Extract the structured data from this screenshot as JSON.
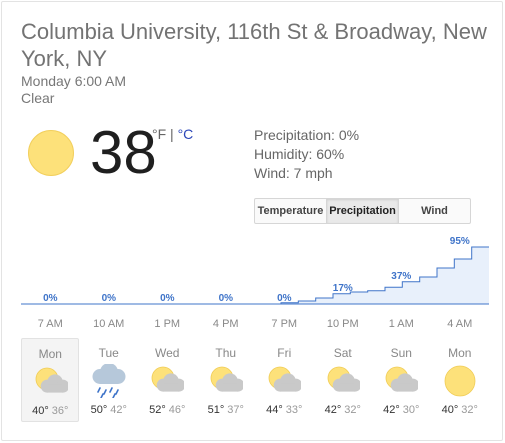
{
  "location": "Columbia University, 116th St & Broadway, New York, NY",
  "time": "Monday 6:00 AM",
  "condition": "Clear",
  "current": {
    "temperature": "38",
    "unit_f": "°F",
    "separator": " | ",
    "unit_c": "°C",
    "icon": "sun-icon"
  },
  "details": {
    "precipitation": "Precipitation: 0%",
    "humidity": "Humidity: 60%",
    "wind": "Wind: 7 mph"
  },
  "tabs": [
    {
      "label": "Temperature",
      "active": false
    },
    {
      "label": "Precipitation",
      "active": true
    },
    {
      "label": "Wind",
      "active": false
    }
  ],
  "chart_data": {
    "type": "area",
    "series": [
      {
        "values": [
          0,
          0,
          0,
          0,
          0,
          17,
          37,
          95
        ]
      }
    ],
    "categories": [
      "7 AM",
      "10 AM",
      "1 PM",
      "4 PM",
      "7 PM",
      "10 PM",
      "1 AM",
      "4 AM"
    ],
    "value_labels": [
      "0%",
      "0%",
      "0%",
      "0%",
      "0%",
      "17%",
      "37%",
      "95%"
    ],
    "steps": [
      0,
      0,
      0,
      0,
      0,
      0,
      0,
      0,
      0,
      0,
      0,
      0,
      0,
      0,
      0,
      2,
      5,
      10,
      17,
      20,
      22,
      28,
      37,
      45,
      60,
      75,
      95
    ],
    "ylim": [
      0,
      100
    ],
    "color": "#3f74c9",
    "fill": "#e8f0fb"
  },
  "forecast": [
    {
      "day": "Mon",
      "hi": "40°",
      "lo": "36°",
      "icon": "partly-cloudy-icon",
      "selected": true
    },
    {
      "day": "Tue",
      "hi": "50°",
      "lo": "42°",
      "icon": "rain-icon",
      "selected": false
    },
    {
      "day": "Wed",
      "hi": "52°",
      "lo": "46°",
      "icon": "partly-cloudy-icon",
      "selected": false
    },
    {
      "day": "Thu",
      "hi": "51°",
      "lo": "37°",
      "icon": "partly-cloudy-icon",
      "selected": false
    },
    {
      "day": "Fri",
      "hi": "44°",
      "lo": "33°",
      "icon": "partly-cloudy-icon",
      "selected": false
    },
    {
      "day": "Sat",
      "hi": "42°",
      "lo": "32°",
      "icon": "partly-cloudy-icon",
      "selected": false
    },
    {
      "day": "Sun",
      "hi": "42°",
      "lo": "30°",
      "icon": "partly-cloudy-icon",
      "selected": false
    },
    {
      "day": "Mon",
      "hi": "40°",
      "lo": "32°",
      "icon": "sun-icon",
      "selected": false
    }
  ],
  "colors": {
    "sun": "#fde17a",
    "cloud": "#c9c9c9",
    "rain_cloud": "#b6c8da",
    "rain": "#3f74c9"
  }
}
